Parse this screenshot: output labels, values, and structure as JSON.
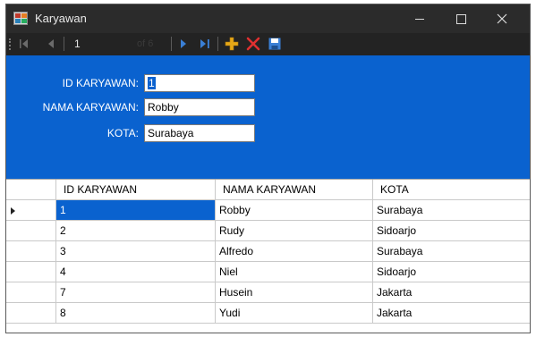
{
  "window": {
    "title": "Karyawan"
  },
  "navigator": {
    "position": "1",
    "count_label": "of 6"
  },
  "form": {
    "id_label": "ID KARYAWAN:",
    "id_value": "1",
    "nama_label": "NAMA KARYAWAN:",
    "nama_value": "Robby",
    "kota_label": "KOTA:",
    "kota_value": "Surabaya"
  },
  "grid": {
    "columns": [
      "ID KARYAWAN",
      "NAMA KARYAWAN",
      "KOTA"
    ],
    "rows": [
      [
        "1",
        "Robby",
        "Surabaya"
      ],
      [
        "2",
        "Rudy",
        "Sidoarjo"
      ],
      [
        "3",
        "Alfredo",
        "Surabaya"
      ],
      [
        "4",
        "Niel",
        "Sidoarjo"
      ],
      [
        "7",
        "Husein",
        "Jakarta"
      ],
      [
        "8",
        "Yudi",
        "Jakarta"
      ]
    ]
  },
  "colors": {
    "accent": "#0a62cf",
    "titlebar": "#2b2b2b",
    "toolbar": "#232323",
    "add_icon": "#e6a817",
    "delete_icon": "#e03030",
    "nav_icon": "#3a7fd5"
  },
  "icons": {
    "move_first": "move-first-icon",
    "move_previous": "move-previous-icon",
    "move_next": "move-next-icon",
    "move_last": "move-last-icon",
    "add_new": "add-new-icon",
    "delete": "delete-icon",
    "save": "save-icon"
  }
}
